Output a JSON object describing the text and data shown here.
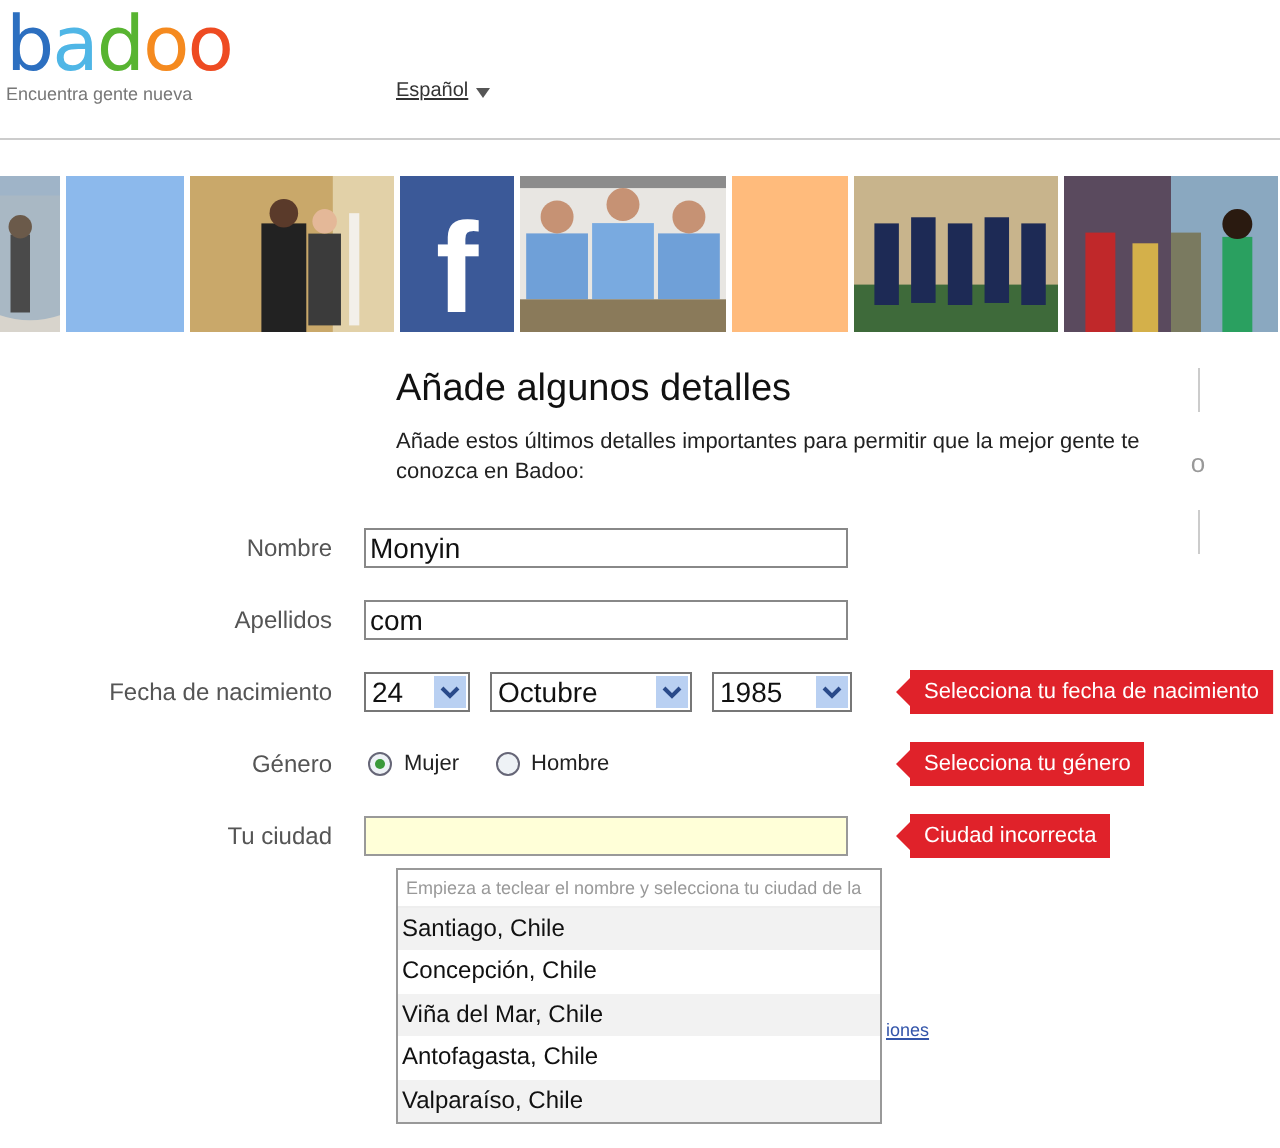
{
  "header": {
    "logo": [
      {
        "char": "b",
        "color": "#2c6fc0"
      },
      {
        "char": "a",
        "color": "#4fb6e6"
      },
      {
        "char": "d",
        "color": "#58b431"
      },
      {
        "char": "o",
        "color": "#f58a1f"
      },
      {
        "char": "o",
        "color": "#ee4b22"
      }
    ],
    "tagline": "Encuentra gente nueva",
    "language": "Español"
  },
  "photo_strip": [
    {
      "kind": "picture"
    },
    {
      "kind": "color",
      "color": "#8cb9ec"
    },
    {
      "kind": "picture"
    },
    {
      "kind": "logo",
      "text": "f"
    },
    {
      "kind": "picture"
    },
    {
      "kind": "color",
      "color": "#ffbb7c"
    },
    {
      "kind": "picture"
    },
    {
      "kind": "picture"
    }
  ],
  "form": {
    "title": "Añade algunos detalles",
    "description": "Añade estos últimos detalles importantes para permitir que la mejor gente te conozca en Badoo:",
    "side_text": "o",
    "fields": [
      {
        "kind": "text",
        "label": "Nombre",
        "value": "Monyin"
      },
      {
        "kind": "text",
        "label": "Apellidos",
        "value": "com"
      },
      {
        "kind": "date",
        "label": "Fecha de nacimiento",
        "day": "24",
        "month": "Octubre",
        "year": "1985",
        "error": "Selecciona tu fecha de nacimiento"
      },
      {
        "kind": "radio",
        "label": "Género",
        "options": [
          {
            "label": "Mujer",
            "selected": true
          },
          {
            "label": "Hombre",
            "selected": false
          }
        ],
        "error": "Selecciona tu género"
      },
      {
        "kind": "city",
        "label": "Tu ciudad",
        "error": "Ciudad incorrecta"
      }
    ],
    "city_suggestions": {
      "hint": "Empieza a teclear el nombre y selecciona tu ciudad de la",
      "items": [
        "Santiago, Chile",
        "Concepción, Chile",
        "Viña del Mar, Chile",
        "Antofagasta, Chile",
        "Valparaíso, Chile"
      ]
    },
    "partial_link": "iones"
  }
}
